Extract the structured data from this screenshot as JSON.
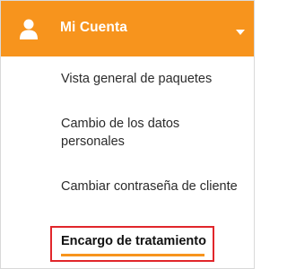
{
  "header": {
    "title": "Mi Cuenta",
    "background_color": "#f7941d",
    "icon": "user-icon",
    "toggle_icon": "caret-down-icon"
  },
  "menu": {
    "items": [
      {
        "label": "Vista general de paquetes"
      },
      {
        "label": "Cambio de los datos personales"
      },
      {
        "label": "Cambiar contraseña de cliente"
      },
      {
        "label": "Encargo de tratamiento",
        "active": true
      }
    ],
    "highlight_border_color": "#e1262b",
    "active_underline_color": "#f7941d"
  }
}
